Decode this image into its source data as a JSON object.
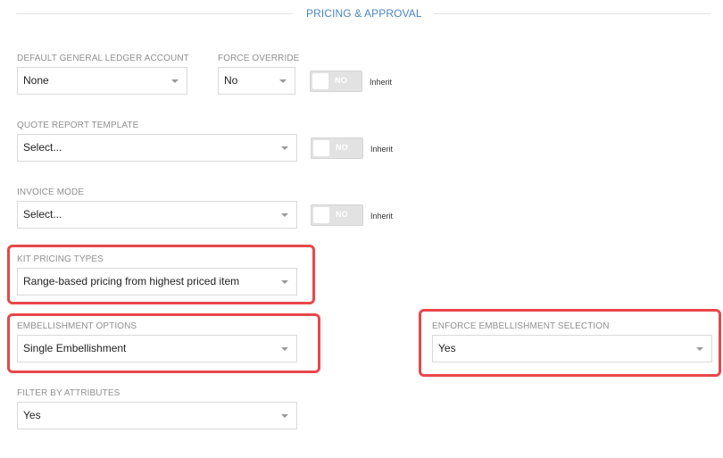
{
  "section": {
    "title": "PRICING & APPROVAL"
  },
  "fields": {
    "default_gl_account": {
      "label": "DEFAULT GENERAL LEDGER ACCOUNT",
      "value": "None"
    },
    "force_override": {
      "label": "FORCE OVERRIDE",
      "value": "No"
    },
    "quote_report_template": {
      "label": "QUOTE REPORT TEMPLATE",
      "value": "Select..."
    },
    "invoice_mode": {
      "label": "INVOICE MODE",
      "value": "Select..."
    },
    "kit_pricing_types": {
      "label": "KIT PRICING TYPES",
      "value": "Range-based pricing from highest priced item"
    },
    "embellishment_options": {
      "label": "EMBELLISHMENT OPTIONS",
      "value": "Single Embellishment"
    },
    "enforce_embellishment_selection": {
      "label": "ENFORCE EMBELLISHMENT SELECTION",
      "value": "Yes"
    },
    "filter_by_attributes": {
      "label": "FILTER BY ATTRIBUTES",
      "value": "Yes"
    }
  },
  "toggles": {
    "force_override": {
      "state": "NO",
      "inherit_label": "Inherit"
    },
    "quote_report_template": {
      "state": "NO",
      "inherit_label": "Inherit"
    },
    "invoice_mode": {
      "state": "NO",
      "inherit_label": "Inherit"
    }
  },
  "colors": {
    "accent": "#4a86c5",
    "highlight": "#e8474a",
    "toggle_off": "#e2e2e2"
  }
}
